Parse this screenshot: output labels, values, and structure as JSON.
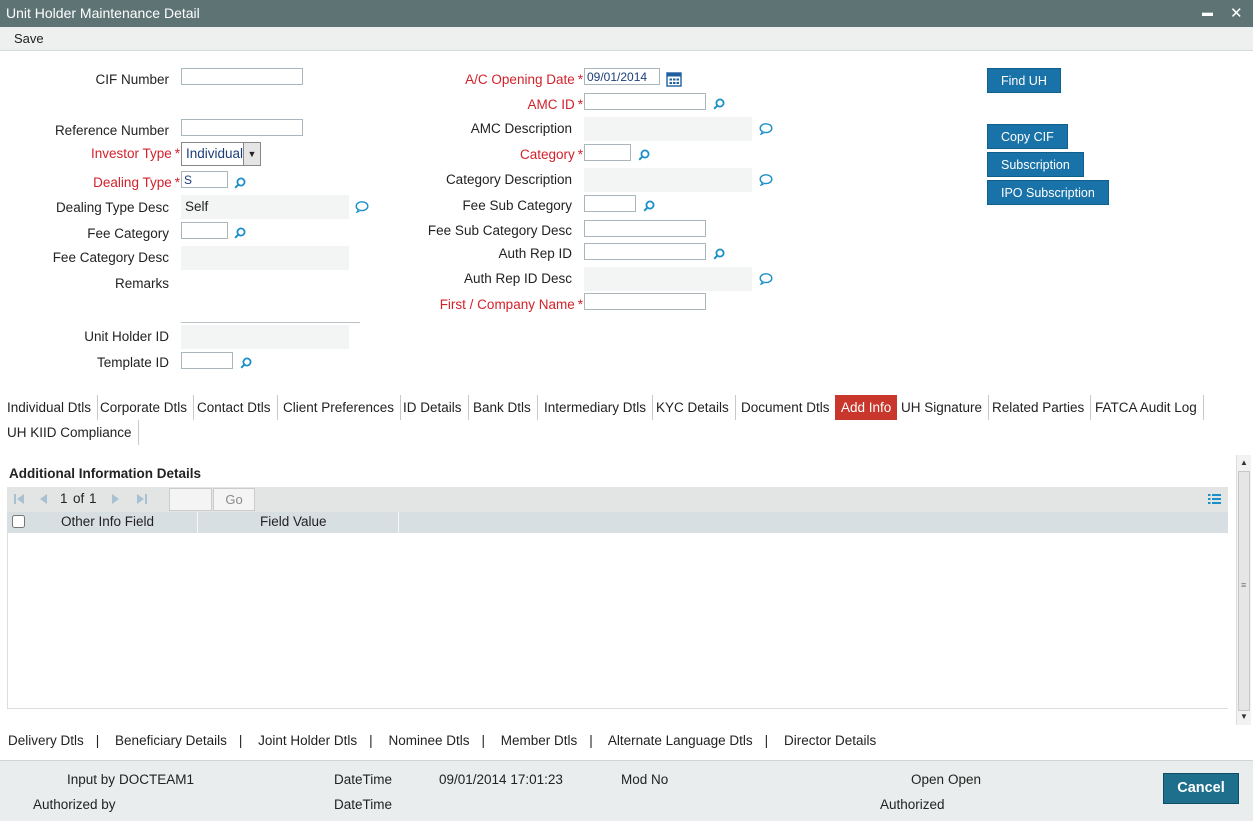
{
  "window": {
    "title": "Unit Holder Maintenance Detail",
    "minimize_glyph": "▬",
    "close_glyph": "✕"
  },
  "menu": {
    "save": "Save"
  },
  "form": {
    "cif_number": {
      "label": "CIF Number",
      "value": ""
    },
    "reference_number": {
      "label": "Reference Number",
      "value": ""
    },
    "investor_type": {
      "label": "Investor Type",
      "value": "Individual"
    },
    "dealing_type": {
      "label": "Dealing Type",
      "value": "S"
    },
    "dealing_type_desc": {
      "label": "Dealing Type Desc",
      "value": "Self"
    },
    "fee_category": {
      "label": "Fee Category",
      "value": ""
    },
    "fee_category_desc": {
      "label": "Fee Category Desc",
      "value": ""
    },
    "remarks": {
      "label": "Remarks",
      "value": ""
    },
    "unit_holder_id": {
      "label": "Unit Holder ID",
      "value": ""
    },
    "template_id": {
      "label": "Template ID",
      "value": ""
    },
    "ac_opening_date": {
      "label": "A/C Opening Date",
      "value": "09/01/2014"
    },
    "amc_id": {
      "label": "AMC ID",
      "value": ""
    },
    "amc_description": {
      "label": "AMC Description",
      "value": ""
    },
    "category": {
      "label": "Category",
      "value": ""
    },
    "category_description": {
      "label": "Category Description",
      "value": ""
    },
    "fee_sub_category": {
      "label": "Fee Sub Category",
      "value": ""
    },
    "fee_sub_category_desc": {
      "label": "Fee Sub Category Desc",
      "value": ""
    },
    "auth_rep_id": {
      "label": "Auth Rep ID",
      "value": ""
    },
    "auth_rep_id_desc": {
      "label": "Auth Rep ID Desc",
      "value": ""
    },
    "first_company_name": {
      "label": "First / Company Name",
      "value": ""
    },
    "required_marker": "*"
  },
  "actions": {
    "find_uh": "Find UH",
    "copy_cif": "Copy CIF",
    "subscription": "Subscription",
    "ipo_subscription": "IPO Subscription"
  },
  "tabs": [
    "Individual Dtls",
    "Corporate Dtls",
    "Contact Dtls",
    "Client Preferences",
    "ID Details",
    "Bank Dtls",
    "Intermediary Dtls",
    "KYC Details",
    "Document Dtls",
    "Add Info",
    "UH Signature",
    "Related Parties",
    "FATCA Audit Log",
    "UH KIID Compliance"
  ],
  "active_tab": "Add Info",
  "additional_info": {
    "title": "Additional Information Details",
    "pager": {
      "current": "1",
      "of_label": "of",
      "total": "1",
      "go": "Go"
    },
    "columns": [
      "Other Info Field",
      "Field Value"
    ],
    "rows": []
  },
  "bottom_links": [
    "Delivery Dtls",
    "Beneficiary Details",
    "Joint Holder Dtls",
    "Nominee Dtls",
    "Member Dtls",
    "Alternate Language Dtls",
    "Director Details"
  ],
  "bottom_sep": "|",
  "footer": {
    "input_by_label": "Input by",
    "input_by_value": "DOCTEAM1",
    "datetime_label": "DateTime",
    "datetime_value": "09/01/2014 17:01:23",
    "mod_no_label": "Mod No",
    "open_label": "Open",
    "open_value": "Open",
    "authorized_by_label": "Authorized by",
    "datetime2_label": "DateTime",
    "authorized_label": "Authorized",
    "cancel": "Cancel"
  },
  "colors": {
    "titlebar": "#5d7374",
    "required": "#d3212a",
    "button": "#1a73a8",
    "active_tab": "#c9362b",
    "cancel": "#1d6f8c"
  }
}
